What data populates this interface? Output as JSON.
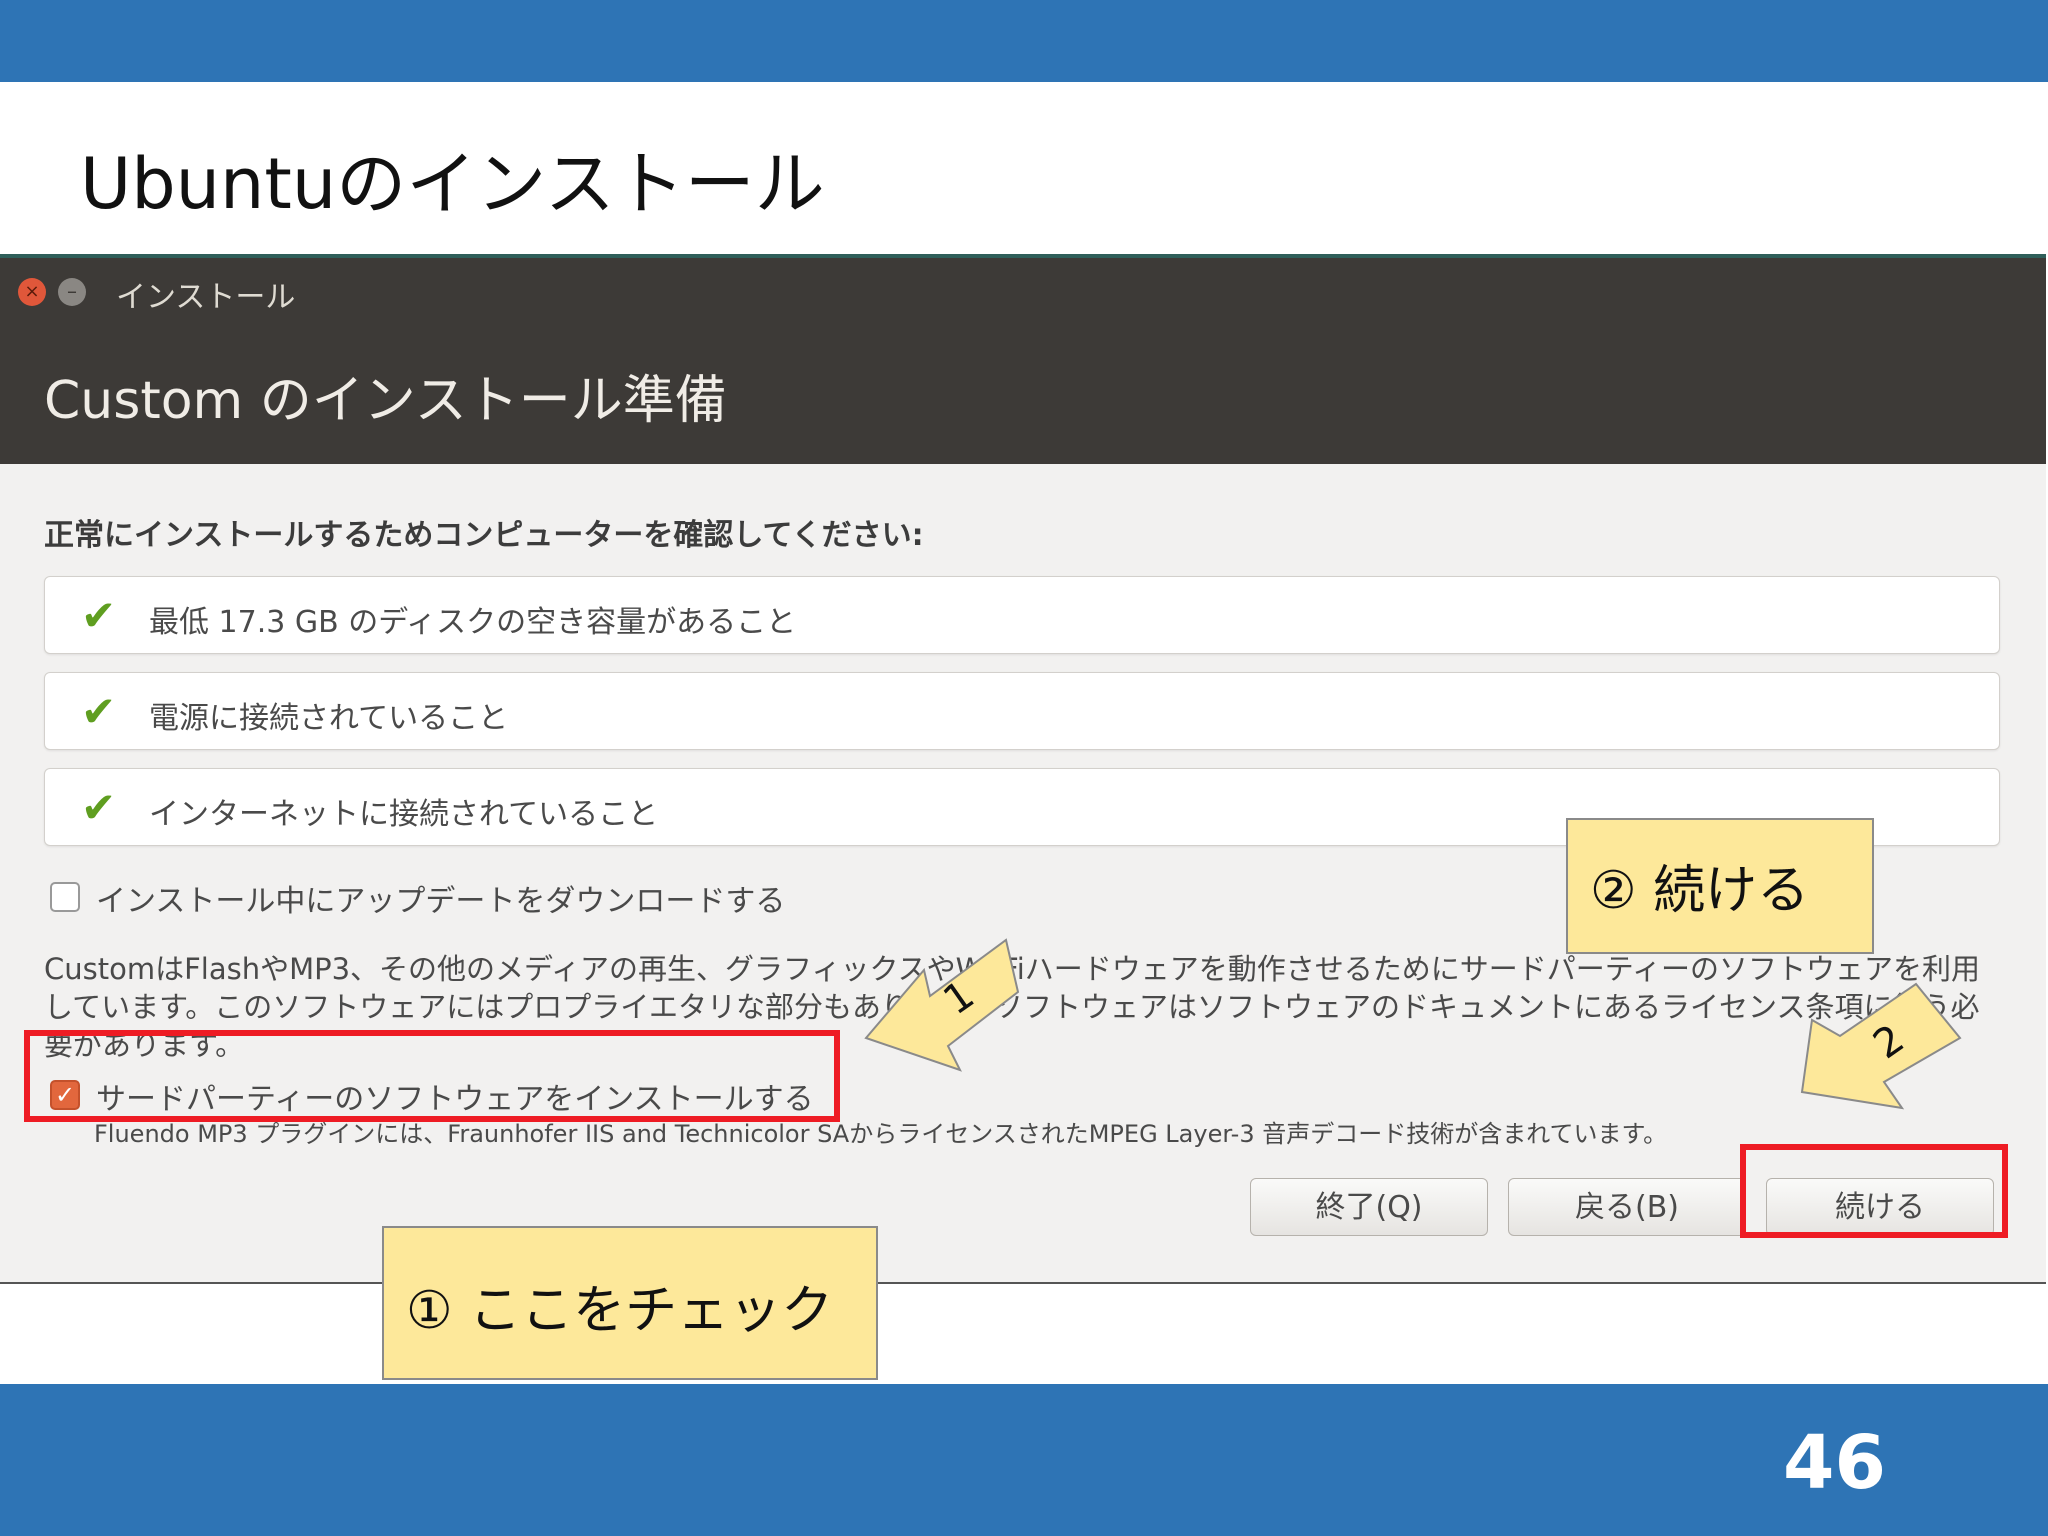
{
  "slide": {
    "title": "Ubuntuのインストール",
    "page_number": "46"
  },
  "window": {
    "title": "インストール",
    "close_glyph": "×",
    "minimize_glyph": "–",
    "header": "Custom のインストール準備",
    "check_heading": "正常にインストールするためコンピューターを確認してください:",
    "requirements": [
      "最低 17.3 GB のディスクの空き容量があること",
      "電源に接続されていること",
      "インターネットに接続されていること"
    ],
    "tick_glyph": "✔",
    "download_updates_label": "インストール中にアップデートをダウンロードする",
    "download_updates_checked": false,
    "description": "CustomはFlashやMP3、その他のメディアの再生、グラフィックスやWi-Fiハードウェアを動作させるためにサードパーティーのソフトウェアを利用しています。このソフトウェアにはプロプライエタリな部分もあります。ソフトウェアはソフトウェアのドキュメントにあるライセンス条項に従う必要があります。",
    "third_party_label": "サードパーティーのソフトウェアをインストールする",
    "third_party_checked": true,
    "check_glyph": "✓",
    "mp3_note": "Fluendo MP3 プラグインには、Fraunhofer IIS and Technicolor SAからライセンスされたMPEG Layer-3 音声デコード技術が含まれています。",
    "buttons": {
      "quit": "終了(Q)",
      "back": "戻る(B)",
      "continue": "続ける"
    }
  },
  "annotations": {
    "callout_1": "① ここをチェック",
    "callout_2": "② 続ける",
    "arrow_1_label": "1",
    "arrow_2_label": "2",
    "highlight_color": "#ee1c24",
    "callout_color": "#fde89a"
  }
}
